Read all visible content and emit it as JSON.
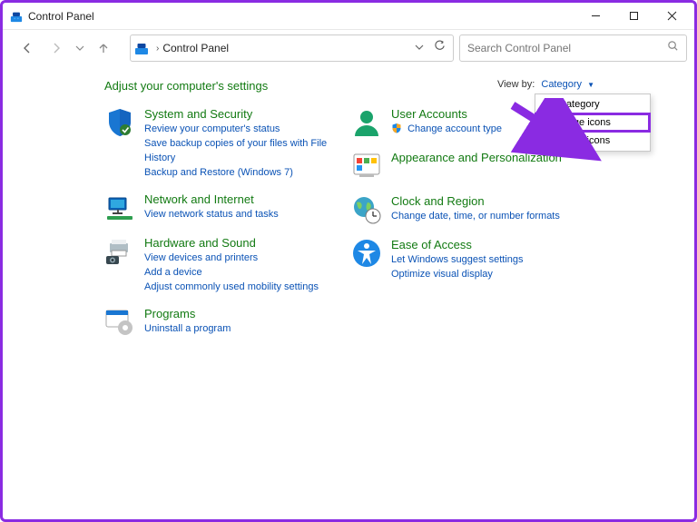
{
  "window": {
    "title": "Control Panel"
  },
  "nav": {
    "breadcrumb": "Control Panel",
    "search_placeholder": "Search Control Panel"
  },
  "heading": "Adjust your computer's settings",
  "viewby": {
    "label": "View by:",
    "current": "Category",
    "options": [
      "Category",
      "Large icons",
      "Small icons"
    ]
  },
  "left": [
    {
      "title": "System and Security",
      "links": [
        "Review your computer's status",
        "Save backup copies of your files with File History",
        "Backup and Restore (Windows 7)"
      ]
    },
    {
      "title": "Network and Internet",
      "links": [
        "View network status and tasks"
      ]
    },
    {
      "title": "Hardware and Sound",
      "links": [
        "View devices and printers",
        "Add a device",
        "Adjust commonly used mobility settings"
      ]
    },
    {
      "title": "Programs",
      "links": [
        "Uninstall a program"
      ]
    }
  ],
  "right": [
    {
      "title": "User Accounts",
      "links": [
        "Change account type"
      ],
      "shield": true
    },
    {
      "title": "Appearance and Personalization",
      "links": []
    },
    {
      "title": "Clock and Region",
      "links": [
        "Change date, time, or number formats"
      ]
    },
    {
      "title": "Ease of Access",
      "links": [
        "Let Windows suggest settings",
        "Optimize visual display"
      ]
    }
  ]
}
